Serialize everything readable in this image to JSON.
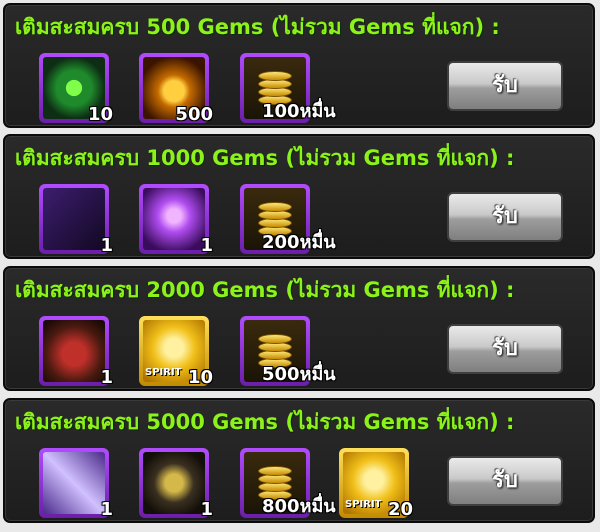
{
  "rewards": [
    {
      "title": "เติมสะสมครบ 500 Gems (ไม่รวม Gems ที่แจก) :",
      "claim_label": "รับ",
      "items": [
        {
          "icon": "swirl-potion-icon",
          "qty": "10",
          "frame": "purple"
        },
        {
          "icon": "golden-bomb-icon",
          "qty": "500",
          "frame": "purple"
        },
        {
          "icon": "gold-coins-icon",
          "qty": "100หมื่น",
          "frame": "purple"
        }
      ]
    },
    {
      "title": "เติมสะสมครบ 1000 Gems (ไม่รวม Gems ที่แจก) :",
      "claim_label": "รับ",
      "items": [
        {
          "icon": "dark-armor-icon",
          "qty": "1",
          "frame": "purple"
        },
        {
          "icon": "purple-orb-icon",
          "qty": "1",
          "frame": "purple"
        },
        {
          "icon": "gold-coins-icon",
          "qty": "200หมื่น",
          "frame": "purple"
        }
      ]
    },
    {
      "title": "เติมสะสมครบ 2000 Gems (ไม่รวม Gems ที่แจก) :",
      "claim_label": "รับ",
      "items": [
        {
          "icon": "horned-beast-icon",
          "qty": "1",
          "frame": "purple"
        },
        {
          "icon": "spirit-box-icon",
          "qty": "10",
          "frame": "gold",
          "tag": "SPIRIT"
        },
        {
          "icon": "gold-coins-icon",
          "qty": "500หมื่น",
          "frame": "purple"
        }
      ]
    },
    {
      "title": "เติมสะสมครบ 5000 Gems (ไม่รวม Gems ที่แจก) :",
      "claim_label": "รับ",
      "items": [
        {
          "icon": "winged-staff-icon",
          "qty": "1",
          "frame": "purple"
        },
        {
          "icon": "horned-helmet-icon",
          "qty": "1",
          "frame": "purple"
        },
        {
          "icon": "gold-coins-icon",
          "qty": "800หมื่น",
          "frame": "purple"
        },
        {
          "icon": "spirit-box-icon",
          "qty": "20",
          "frame": "gold",
          "tag": "SPIRIT"
        }
      ]
    }
  ],
  "colors": {
    "title_green": "#8cf21a",
    "frame_purple": "#9b3de0",
    "frame_gold": "#f1c01a",
    "panel_bg": "#222222"
  }
}
